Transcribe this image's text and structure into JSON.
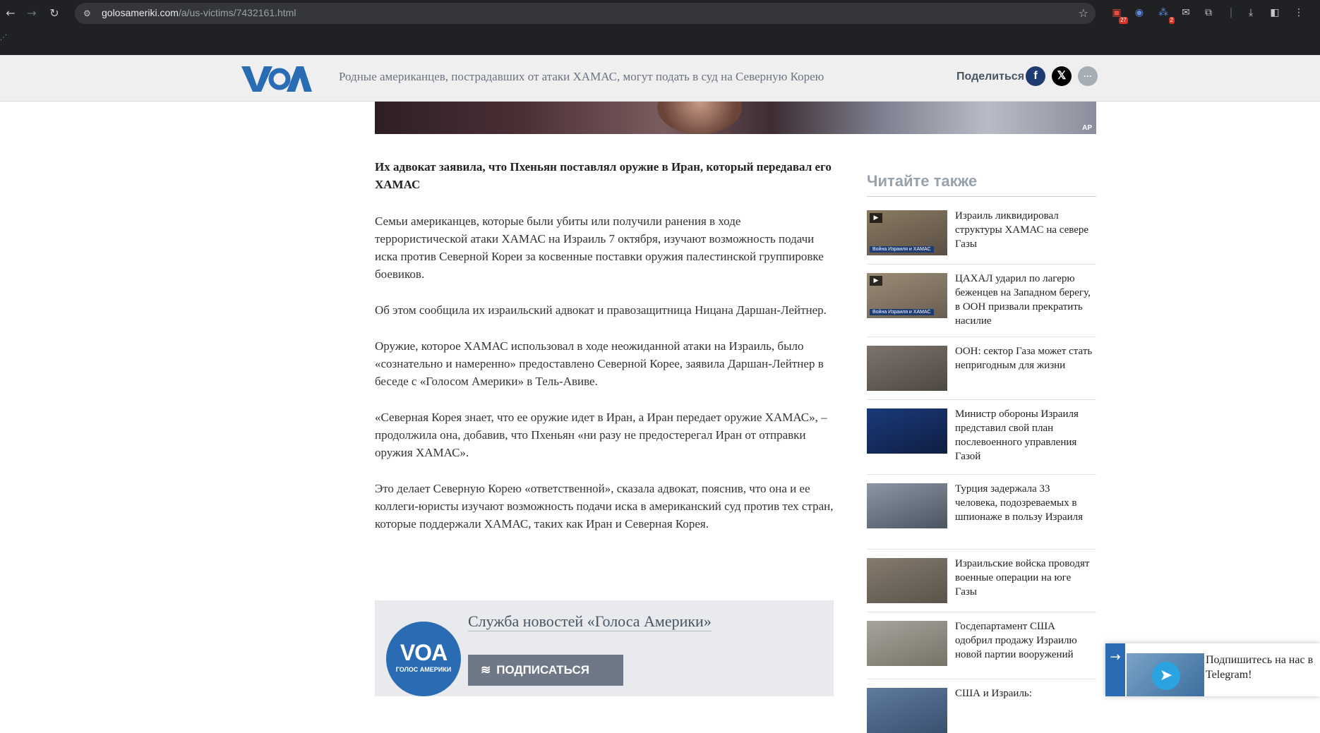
{
  "browser": {
    "url_domain": "golosameriki.com",
    "url_path": "/a/us-victims/7432161.html",
    "extensions": [
      {
        "icon": "ext-red-icon",
        "badge": "27"
      },
      {
        "icon": "ext-blue-icon",
        "badge": ""
      },
      {
        "icon": "ext-dots-icon",
        "badge": "2"
      },
      {
        "icon": "mail-icon",
        "badge": ""
      },
      {
        "icon": "puzzle-icon",
        "badge": ""
      }
    ]
  },
  "header": {
    "title": "Родные американцев, пострадавших от атаки ХАМАС, могут подать в суд на Северную Корею",
    "share_label": "Поделиться",
    "facebook": "f",
    "x": "𝕏",
    "more": "···"
  },
  "hero": {
    "credit": "AP"
  },
  "article": {
    "lead": "Их адвокат заявила, что Пхеньян поставлял оружие в Иран, который передавал его ХАМАС",
    "paragraphs": [
      "Семьи американцев, которые были убиты или получили ранения в ходе террористической атаки ХАМАС на Израиль 7 октября, изучают возможность подачи иска против Северной Кореи за косвенные поставки оружия палестинской группировке боевиков.",
      "Об этом сообщила их израильский адвокат и правозащитница Ницана Даршан-Лейтнер.",
      "Оружие, которое ХАМАС использовал в ходе неожиданной атаки на Израиль, было «сознательно и намеренно» предоставлено Северной Корее, заявила Даршан-Лейтнер в беседе с «Голосом Америки» в Тель-Авиве.",
      "«Северная Корея знает, что ее оружие идет в Иран, а Иран передает оружие ХАМАС», – продолжила она, добавив, что Пхеньян «ни разу не предостерегал Иран от отправки оружия ХАМАС».",
      "Это делает Северную Корею «ответственной», сказала адвокат, пояснив, что она и ее коллеги-юристы изучают возможность подачи иска в американский суд против тех стран, которые поддержали ХАМАС, таких как Иран и Северная Корея."
    ]
  },
  "author": {
    "logo_big": "VOA",
    "logo_small": "ГОЛОС АМЕРИКИ",
    "name": "Служба новостей «Голоса Америки»",
    "rss_label": "ПОДПИСАТЬСЯ (RSS)"
  },
  "sidebar": {
    "title": "Читайте также",
    "items": [
      {
        "text": "Израиль ликвидировал структуры ХАМАС на севере Газы",
        "video": true,
        "tag": "Война Израиля и ХАМАС",
        "thumb_colors": [
          "#8a7a62",
          "#5a4f45"
        ]
      },
      {
        "text": "ЦАХАЛ ударил по лагерю беженцев на Западном берегу, в ООН призвали прекратить насилие",
        "video": true,
        "tag": "Война Израиля и ХАМАС",
        "thumb_colors": [
          "#9a8c76",
          "#6a5e52"
        ]
      },
      {
        "text": "ООН: сектор Газа может стать непригодным для жизни",
        "video": false,
        "tag": "",
        "thumb_colors": [
          "#7c746c",
          "#4e4842"
        ]
      },
      {
        "text": "Министр обороны Израиля представил свой план послевоенного управления Газой",
        "video": false,
        "tag": "",
        "thumb_colors": [
          "#1b3a7a",
          "#0f1e42"
        ]
      },
      {
        "text": "Турция задержала 33 человека, подозреваемых в шпионаже в пользу Израиля",
        "video": false,
        "tag": "",
        "thumb_colors": [
          "#8c96a4",
          "#4b5562"
        ]
      },
      {
        "text": "Израильские войска проводят военные операции на юге Газы",
        "video": false,
        "tag": "",
        "thumb_colors": [
          "#857b6f",
          "#5b5349"
        ]
      },
      {
        "text": "Госдепартамент США одобрил продажу Израилю новой партии вооружений",
        "video": false,
        "tag": "",
        "thumb_colors": [
          "#a6a49c",
          "#767266"
        ]
      },
      {
        "text": "США и Израиль:",
        "video": false,
        "tag": "",
        "thumb_colors": [
          "#5f7b9e",
          "#3a5070"
        ]
      }
    ]
  },
  "telegram": {
    "text": "Подпишитесь на нас в Telegram!"
  }
}
